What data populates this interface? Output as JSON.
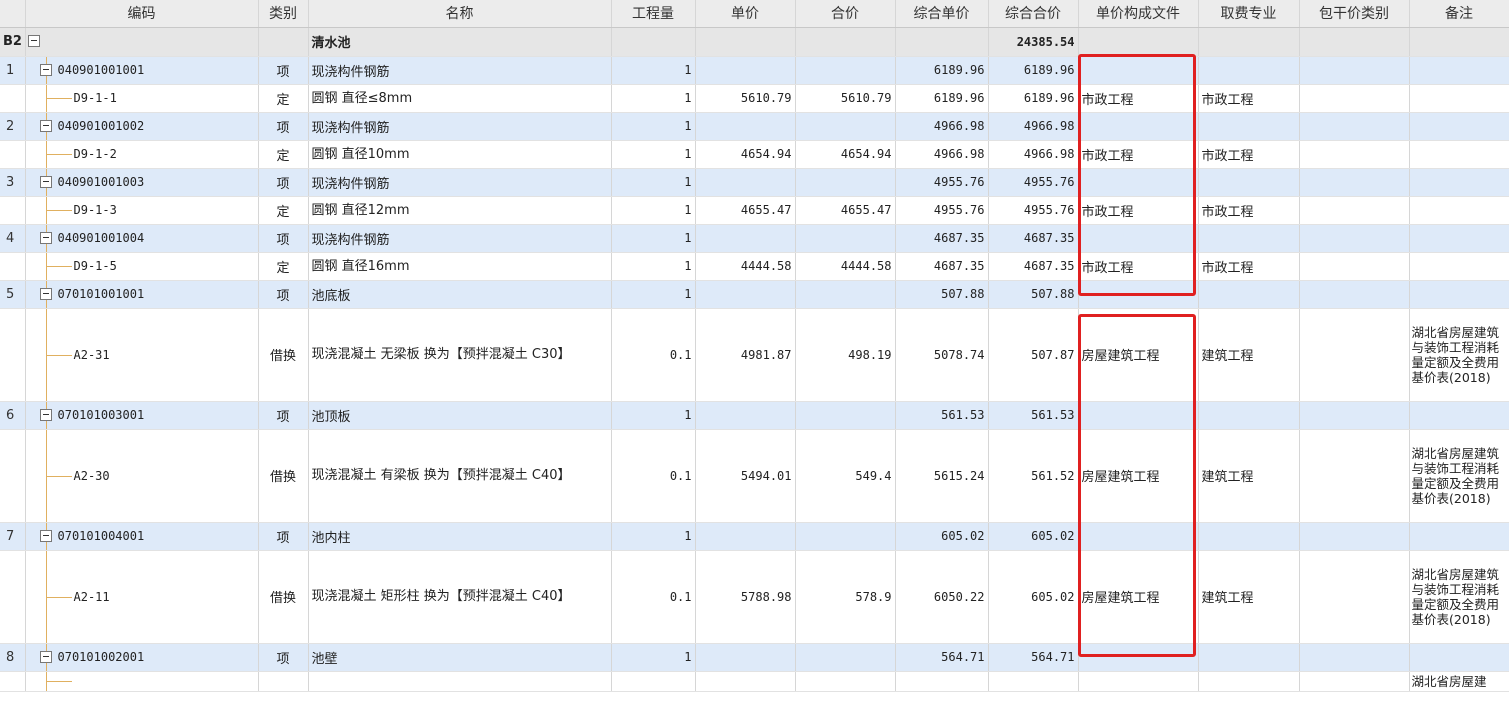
{
  "columns": [
    "编码",
    "类别",
    "名称",
    "工程量",
    "单价",
    "合价",
    "综合单价",
    "综合合价",
    "单价构成文件",
    "取费专业",
    "包干价类别",
    "备注"
  ],
  "group": {
    "id": "B2",
    "name": "清水池",
    "total": "24385.54"
  },
  "rows": [
    {
      "no": "1",
      "code": "040901001001",
      "type": "项",
      "name": "现浇构件钢筋",
      "qty": "1",
      "unit_price": "",
      "amount": "",
      "comp_unit": "6189.96",
      "comp_total": "6189.96",
      "file": "",
      "fee": "",
      "pkg": "",
      "note": "",
      "sub": {
        "code": "D9-1-1",
        "type": "定",
        "name": "圆钢 直径≤8mm",
        "qty": "1",
        "unit_price": "5610.79",
        "amount": "5610.79",
        "comp_unit": "6189.96",
        "comp_total": "6189.96",
        "file": "市政工程",
        "fee": "市政工程",
        "pkg": "",
        "note": ""
      }
    },
    {
      "no": "2",
      "code": "040901001002",
      "type": "项",
      "name": "现浇构件钢筋",
      "qty": "1",
      "unit_price": "",
      "amount": "",
      "comp_unit": "4966.98",
      "comp_total": "4966.98",
      "file": "",
      "fee": "",
      "pkg": "",
      "note": "",
      "sub": {
        "code": "D9-1-2",
        "type": "定",
        "name": "圆钢 直径10mm",
        "qty": "1",
        "unit_price": "4654.94",
        "amount": "4654.94",
        "comp_unit": "4966.98",
        "comp_total": "4966.98",
        "file": "市政工程",
        "fee": "市政工程",
        "pkg": "",
        "note": ""
      }
    },
    {
      "no": "3",
      "code": "040901001003",
      "type": "项",
      "name": "现浇构件钢筋",
      "qty": "1",
      "unit_price": "",
      "amount": "",
      "comp_unit": "4955.76",
      "comp_total": "4955.76",
      "file": "",
      "fee": "",
      "pkg": "",
      "note": "",
      "sub": {
        "code": "D9-1-3",
        "type": "定",
        "name": "圆钢 直径12mm",
        "qty": "1",
        "unit_price": "4655.47",
        "amount": "4655.47",
        "comp_unit": "4955.76",
        "comp_total": "4955.76",
        "file": "市政工程",
        "fee": "市政工程",
        "pkg": "",
        "note": ""
      }
    },
    {
      "no": "4",
      "code": "040901001004",
      "type": "项",
      "name": "现浇构件钢筋",
      "qty": "1",
      "unit_price": "",
      "amount": "",
      "comp_unit": "4687.35",
      "comp_total": "4687.35",
      "file": "",
      "fee": "",
      "pkg": "",
      "note": "",
      "sub": {
        "code": "D9-1-5",
        "type": "定",
        "name": "圆钢 直径16mm",
        "qty": "1",
        "unit_price": "4444.58",
        "amount": "4444.58",
        "comp_unit": "4687.35",
        "comp_total": "4687.35",
        "file": "市政工程",
        "fee": "市政工程",
        "pkg": "",
        "note": ""
      }
    },
    {
      "no": "5",
      "code": "070101001001",
      "type": "项",
      "name": "池底板",
      "qty": "1",
      "unit_price": "",
      "amount": "",
      "comp_unit": "507.88",
      "comp_total": "507.88",
      "file": "",
      "fee": "",
      "pkg": "",
      "note": "",
      "sub": {
        "code": "A2-31",
        "type": "借换",
        "name": "现浇混凝土 无梁板  换为【预拌混凝土 C30】",
        "qty": "0.1",
        "unit_price": "4981.87",
        "amount": "498.19",
        "comp_unit": "5078.74",
        "comp_total": "507.87",
        "file": "房屋建筑工程",
        "fee": "建筑工程",
        "pkg": "",
        "note": "湖北省房屋建筑与装饰工程消耗量定额及全费用基价表(2018)"
      }
    },
    {
      "no": "6",
      "code": "070101003001",
      "type": "项",
      "name": "池顶板",
      "qty": "1",
      "unit_price": "",
      "amount": "",
      "comp_unit": "561.53",
      "comp_total": "561.53",
      "file": "",
      "fee": "",
      "pkg": "",
      "note": "",
      "sub": {
        "code": "A2-30",
        "type": "借换",
        "name": "现浇混凝土 有梁板  换为【预拌混凝土 C40】",
        "qty": "0.1",
        "unit_price": "5494.01",
        "amount": "549.4",
        "comp_unit": "5615.24",
        "comp_total": "561.52",
        "file": "房屋建筑工程",
        "fee": "建筑工程",
        "pkg": "",
        "note": "湖北省房屋建筑与装饰工程消耗量定额及全费用基价表(2018)"
      }
    },
    {
      "no": "7",
      "code": "070101004001",
      "type": "项",
      "name": "池内柱",
      "qty": "1",
      "unit_price": "",
      "amount": "",
      "comp_unit": "605.02",
      "comp_total": "605.02",
      "file": "",
      "fee": "",
      "pkg": "",
      "note": "",
      "sub": {
        "code": "A2-11",
        "type": "借换",
        "name": "现浇混凝土 矩形柱  换为【预拌混凝土 C40】",
        "qty": "0.1",
        "unit_price": "5788.98",
        "amount": "578.9",
        "comp_unit": "6050.22",
        "comp_total": "605.02",
        "file": "房屋建筑工程",
        "fee": "建筑工程",
        "pkg": "",
        "note": "湖北省房屋建筑与装饰工程消耗量定额及全费用基价表(2018)"
      }
    },
    {
      "no": "8",
      "code": "070101002001",
      "type": "项",
      "name": "池壁",
      "qty": "1",
      "unit_price": "",
      "amount": "",
      "comp_unit": "564.71",
      "comp_total": "564.71",
      "file": "",
      "fee": "",
      "pkg": "",
      "note": "",
      "sub": {
        "code": "",
        "type": "",
        "name": "",
        "qty": "",
        "unit_price": "",
        "amount": "",
        "comp_unit": "",
        "comp_total": "",
        "file": "",
        "fee": "",
        "pkg": "",
        "note": "湖北省房屋建"
      }
    }
  ],
  "colors": {
    "header_bg": "#ececec",
    "group_bg": "#e6e6e6",
    "item_bg": "#deeaf9",
    "highlight": "#e02020",
    "tree_line": "#e0b060"
  }
}
